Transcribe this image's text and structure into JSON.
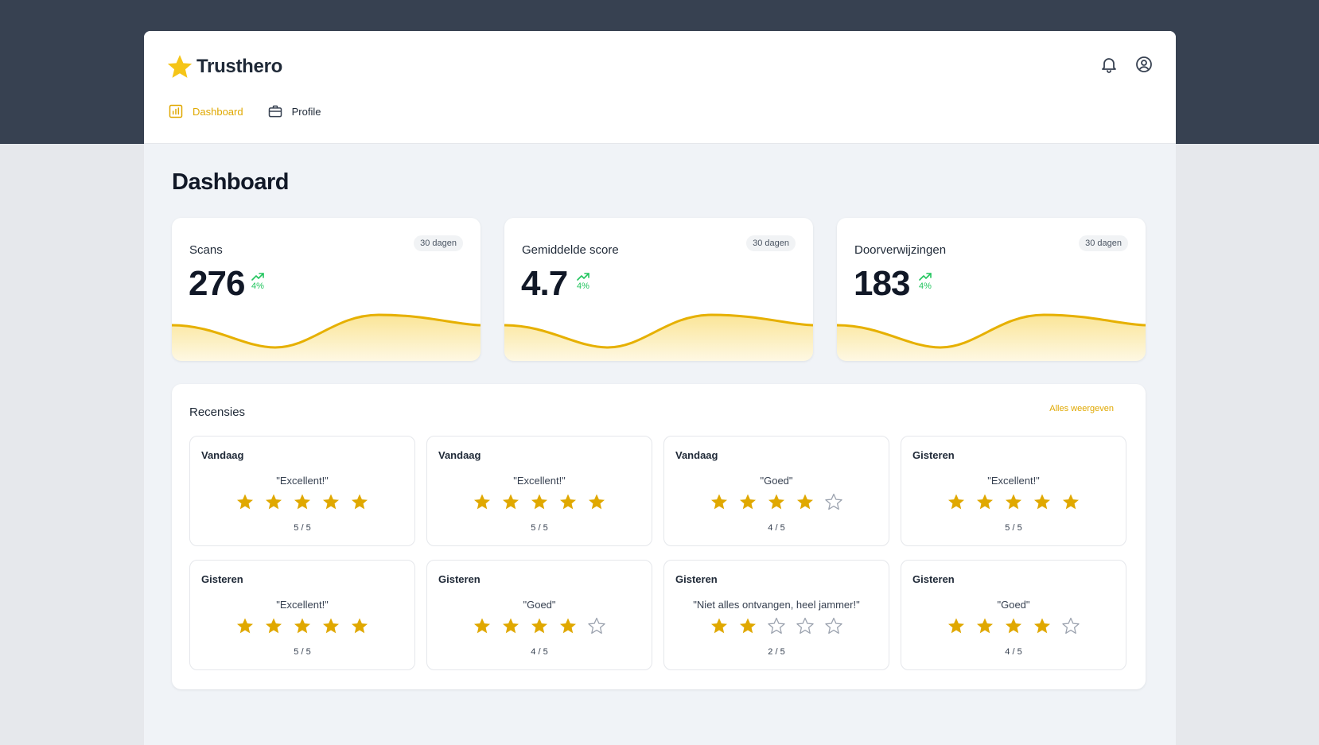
{
  "app": {
    "name": "Trusthero"
  },
  "colors": {
    "accent": "#e0a800",
    "star_empty": "#9ca3af",
    "trend": "#22c55e",
    "header_band": "#374151"
  },
  "icons": {
    "logo": "star-icon",
    "notifications": "bell-icon",
    "account": "user-circle-icon"
  },
  "nav": [
    {
      "label": "Dashboard",
      "icon": "bar-chart-icon",
      "active": true
    },
    {
      "label": "Profile",
      "icon": "briefcase-icon",
      "active": false
    }
  ],
  "page": {
    "title": "Dashboard"
  },
  "stats": [
    {
      "label": "Scans",
      "period": "30 dagen",
      "value": "276",
      "trend": "4%"
    },
    {
      "label": "Gemiddelde score",
      "period": "30 dagen",
      "value": "4.7",
      "trend": "4%"
    },
    {
      "label": "Doorverwijzingen",
      "period": "30 dagen",
      "value": "183",
      "trend": "4%"
    }
  ],
  "reviews_section": {
    "title": "Recensies",
    "view_all": "Alles weergeven"
  },
  "reviews": [
    {
      "day": "Vandaag",
      "text": "\"Excellent!\"",
      "rating": 5,
      "score": "5 / 5"
    },
    {
      "day": "Vandaag",
      "text": "\"Excellent!\"",
      "rating": 5,
      "score": "5 / 5"
    },
    {
      "day": "Vandaag",
      "text": "\"Goed\"",
      "rating": 4,
      "score": "4 / 5"
    },
    {
      "day": "Gisteren",
      "text": "\"Excellent!\"",
      "rating": 5,
      "score": "5 / 5"
    },
    {
      "day": "Gisteren",
      "text": "\"Excellent!\"",
      "rating": 5,
      "score": "5 / 5"
    },
    {
      "day": "Gisteren",
      "text": "\"Goed\"",
      "rating": 4,
      "score": "4 / 5"
    },
    {
      "day": "Gisteren",
      "text": "\"Niet alles ontvangen, heel jammer!\"",
      "rating": 2,
      "score": "2 / 5"
    },
    {
      "day": "Gisteren",
      "text": "\"Goed\"",
      "rating": 4,
      "score": "4 / 5"
    }
  ]
}
